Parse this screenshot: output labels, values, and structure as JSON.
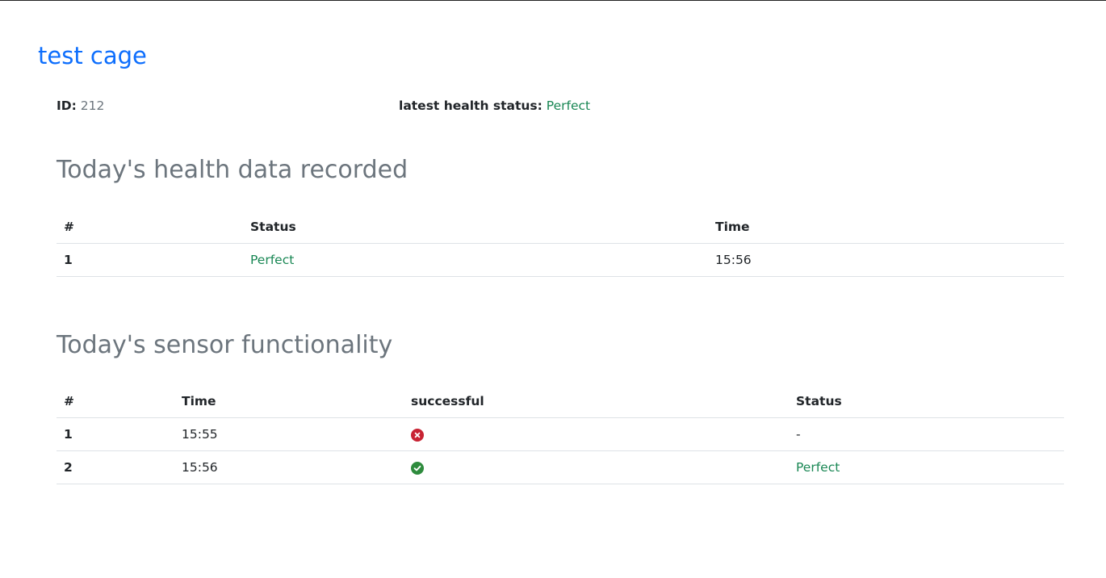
{
  "cage": {
    "title": "test cage",
    "id_label": "ID:",
    "id_value": "212",
    "health_label": "latest health status:",
    "health_value": "Perfect"
  },
  "health_section": {
    "title": "Today's health data recorded",
    "columns": [
      "#",
      "Status",
      "Time"
    ],
    "rows": [
      {
        "num": "1",
        "status": "Perfect",
        "time": "15:56"
      }
    ]
  },
  "sensor_section": {
    "title": "Today's sensor functionality",
    "columns": [
      "#",
      "Time",
      "successful",
      "Status"
    ],
    "rows": [
      {
        "num": "1",
        "time": "15:55",
        "successful_icon": "x-circle-icon",
        "status": "-"
      },
      {
        "num": "2",
        "time": "15:56",
        "successful_icon": "check-circle-icon",
        "status": "Perfect"
      }
    ]
  },
  "colors": {
    "link_blue": "#0d6efd",
    "success_green": "#198754",
    "danger_red": "#c82333",
    "check_green": "#2e8b3d",
    "muted_gray": "#6c757d"
  }
}
